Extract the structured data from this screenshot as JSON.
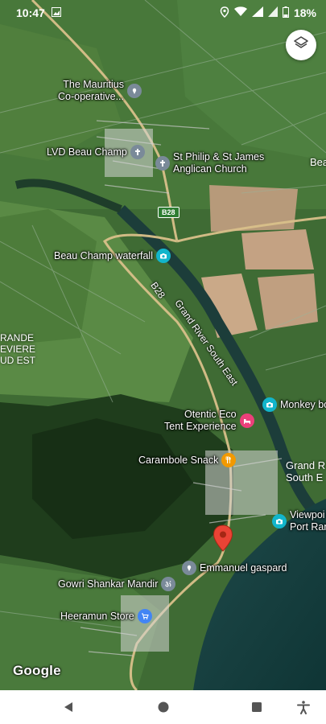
{
  "status_bar": {
    "time": "10:47",
    "battery": "18%"
  },
  "map": {
    "pois": [
      {
        "id": "mauritius-coop",
        "lines": [
          "The Mauritius",
          "Co-operative..."
        ],
        "icon": "location-pin-icon",
        "color": "#7a8a99"
      },
      {
        "id": "lvd-beau-champ",
        "lines": [
          "LVD Beau Champ"
        ],
        "icon": "church-icon",
        "color": "#7a8a99"
      },
      {
        "id": "st-philip",
        "lines": [
          "St Philip & St James",
          "Anglican Church"
        ],
        "icon": "church-icon",
        "color": "#7a8a99"
      },
      {
        "id": "beau-champ-waterfall",
        "lines": [
          "Beau Champ waterfall"
        ],
        "icon": "camera-icon",
        "color": "#12b5cb"
      },
      {
        "id": "otentic-eco",
        "lines": [
          "Otentic Eco",
          "Tent Experience"
        ],
        "icon": "bed-icon",
        "color": "#ec407a"
      },
      {
        "id": "monkey-box",
        "lines": [
          "Monkey bo"
        ],
        "icon": "camera-icon",
        "color": "#12b5cb"
      },
      {
        "id": "carambole-snack",
        "lines": [
          "Carambole Snack"
        ],
        "icon": "fork-knife-icon",
        "color": "#f29900"
      },
      {
        "id": "viewpoint",
        "lines": [
          "Viewpoi",
          "Port Ran"
        ],
        "icon": "camera-icon",
        "color": "#12b5cb"
      },
      {
        "id": "emmanuel-gaspard",
        "lines": [
          "Emmanuel gaspard"
        ],
        "icon": "location-pin-icon",
        "color": "#7a8a99"
      },
      {
        "id": "gowri-shankar",
        "lines": [
          "Gowri Shankar Mandir"
        ],
        "icon": "om-icon",
        "color": "#7a8a99"
      },
      {
        "id": "heeramun-store",
        "lines": [
          "Heeramun Store"
        ],
        "icon": "shopping-cart-icon",
        "color": "#4285f4"
      }
    ],
    "road_labels": {
      "river": "Grand River South East",
      "b28": "B28",
      "b28_shield": "B28"
    },
    "area_labels": {
      "grande_riviere": [
        "RANDE",
        "EVIERE",
        "UD EST"
      ],
      "grand_river_se": [
        "Grand R",
        "South E"
      ],
      "bea": "Bea"
    },
    "dropped_pin": "red-marker-icon",
    "attribution": "Google"
  },
  "nav": {
    "back": "back-icon",
    "home": "home-icon",
    "recents": "recents-icon",
    "accessibility": "accessibility-icon"
  }
}
